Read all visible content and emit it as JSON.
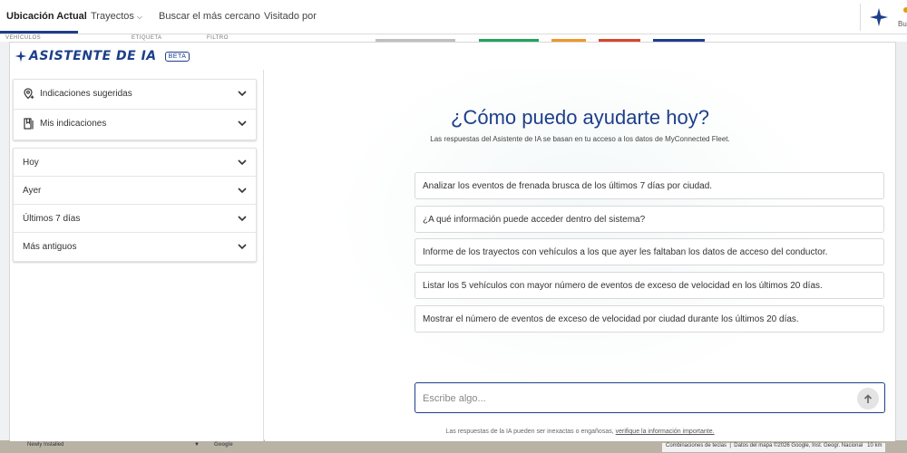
{
  "topbar": {
    "tabs": [
      {
        "label": "Ubicación Actual",
        "active": true
      },
      {
        "label": "Trayectos",
        "active": false
      },
      {
        "label": "Buscar el más cercano",
        "active": false
      },
      {
        "label": "Visitado por",
        "active": false
      }
    ],
    "user_short": "Bu"
  },
  "background": {
    "col_labels": [
      "VEHÍCULOS",
      "ETIQUETA",
      "FILTRO"
    ],
    "status_colors": [
      "#bfbfbf",
      "#21a35a",
      "#f0962a",
      "#d9452e",
      "#1d3f8a"
    ],
    "left_text": "Newly Installed",
    "map_logo": "Google",
    "map_footer": [
      "Combinaciones de teclas",
      "Datos del mapa ©2026 Google, Inst. Geogr. Nacional",
      "10 km"
    ]
  },
  "assistant": {
    "title": "ASISTENTE DE IA",
    "badge": "BETA",
    "accent": "#1d3f8a",
    "sidebar_top": [
      {
        "label": "Indicaciones sugeridas",
        "icon": "map-pin-icon"
      },
      {
        "label": "Mis indicaciones",
        "icon": "bookmark-icon"
      }
    ],
    "history": [
      "Hoy",
      "Ayer",
      "Últimos 7 días",
      "Más antiguos"
    ],
    "heading": "¿Cómo puedo ayudarte hoy?",
    "subheading": "Las respuestas del Asistente de IA se basan en tu acceso a los datos de MyConnected Fleet.",
    "suggestions": [
      "Analizar los eventos de frenada brusca de los últimos 7 días por ciudad.",
      "¿A qué información puede acceder dentro del sistema?",
      "Informe de los trayectos con vehículos a los que ayer les faltaban los datos de acceso del conductor.",
      "Listar los 5 vehículos con mayor número de eventos de exceso de velocidad en los últimos 20 días.",
      "Mostrar el número de eventos de exceso de velocidad por ciudad durante los últimos 20 días."
    ],
    "input_placeholder": "Escribe algo...",
    "disclaimer_text": "Las respuestas de la IA pueden ser inexactas o engañosas,",
    "disclaimer_link": "verifique la información importante."
  }
}
